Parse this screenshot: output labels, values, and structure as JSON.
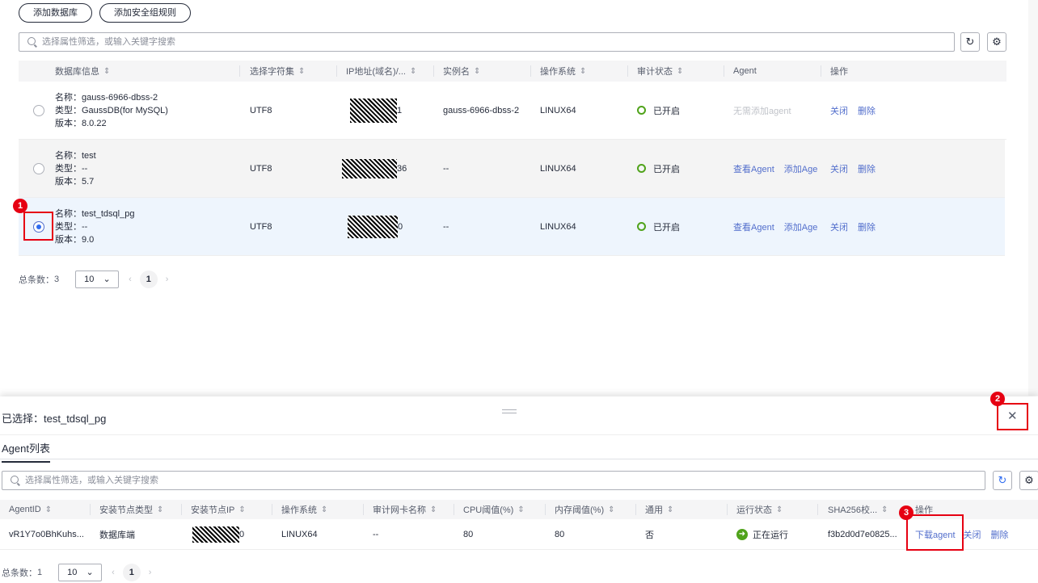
{
  "toolbar": {
    "add_db": "添加数据库",
    "add_sg": "添加安全组规则",
    "search_placeholder": "选择属性筛选，或输入关键字搜索"
  },
  "db_table": {
    "headers": [
      "数据库信息",
      "选择字符集",
      "IP地址(域名)/...",
      "实例名",
      "操作系统",
      "审计状态",
      "Agent",
      "操作"
    ],
    "labels": {
      "name": "名称：",
      "type": "类型：",
      "version": "版本："
    },
    "rows": [
      {
        "name": "gauss-6966-dbss-2",
        "type": "GaussDB(for MySQL)",
        "version": "8.0.22",
        "charset": "UTF8",
        "ip_suffix": "1",
        "instance": "gauss-6966-dbss-2",
        "os": "LINUX64",
        "audit": "已开启",
        "agent": "无需添加agent",
        "ops": [
          "关闭",
          "删除"
        ],
        "selected": false
      },
      {
        "name": "test",
        "type": "--",
        "version": "5.7",
        "charset": "UTF8",
        "ip_suffix": "36",
        "instance": "--",
        "os": "LINUX64",
        "audit": "已开启",
        "agent_links": [
          "查看Agent",
          "添加Age"
        ],
        "ops": [
          "关闭",
          "删除"
        ],
        "selected": false
      },
      {
        "name": "test_tdsql_pg",
        "type": "--",
        "version": "9.0",
        "charset": "UTF8",
        "ip_suffix": "0",
        "instance": "--",
        "os": "LINUX64",
        "audit": "已开启",
        "agent_links": [
          "查看Agent",
          "添加Age"
        ],
        "ops": [
          "关闭",
          "删除"
        ],
        "selected": true
      }
    ]
  },
  "db_pager": {
    "total_label": "总条数：",
    "total": "3",
    "page_size": "10",
    "page": "1"
  },
  "panel": {
    "selected_label": "已选择：",
    "selected_value": "test_tdsql_pg",
    "tab": "Agent列表",
    "search_placeholder": "选择属性筛选，或输入关键字搜索"
  },
  "agent_table": {
    "headers": [
      "AgentID",
      "安装节点类型",
      "安装节点IP",
      "操作系统",
      "审计网卡名称",
      "CPU阈值(%)",
      "内存阈值(%)",
      "通用",
      "运行状态",
      "SHA256校...",
      "操作"
    ],
    "rows": [
      {
        "id": "vR1Y7o0BhKuhs...",
        "node_type": "数据库端",
        "ip_suffix": "0",
        "os": "LINUX64",
        "nic": "--",
        "cpu": "80",
        "mem": "80",
        "general": "否",
        "status": "正在运行",
        "sha": "f3b2d0d7e0825...",
        "ops": [
          "下载agent",
          "关闭",
          "删除"
        ]
      }
    ]
  },
  "agent_pager": {
    "total_label": "总条数：",
    "total": "1",
    "page_size": "10",
    "page": "1"
  },
  "annotations": [
    "1",
    "2",
    "3"
  ]
}
